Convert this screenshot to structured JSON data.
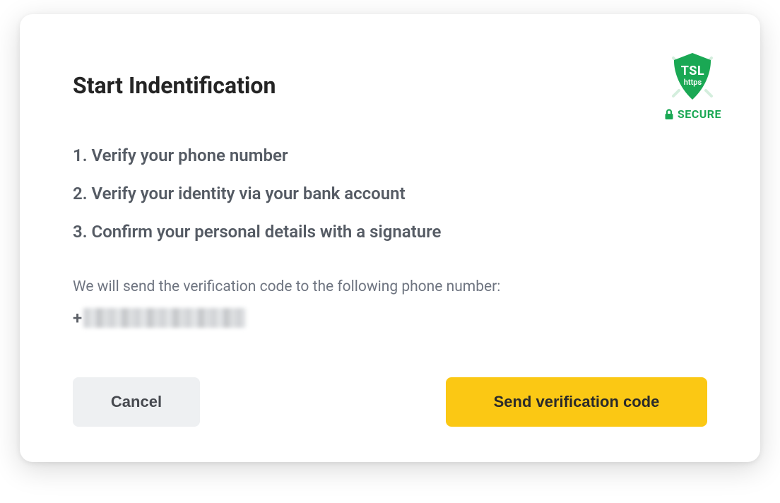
{
  "title": "Start Indentification",
  "secure_badge": {
    "shield_line1": "TSL",
    "shield_line2": "https",
    "label": "SECURE"
  },
  "steps": [
    "1. Verify your phone number",
    "2. Verify your identity via your bank account",
    "3. Confirm your personal details with a signature"
  ],
  "description": "We will send the verification code to the following phone number:",
  "phone_prefix": "+",
  "phone_redacted": true,
  "actions": {
    "cancel_label": "Cancel",
    "send_label": "Send verification code"
  },
  "colors": {
    "accent_green": "#1aa854",
    "accent_yellow": "#fbc814",
    "text_dark": "#242424",
    "text_muted": "#555b64"
  }
}
